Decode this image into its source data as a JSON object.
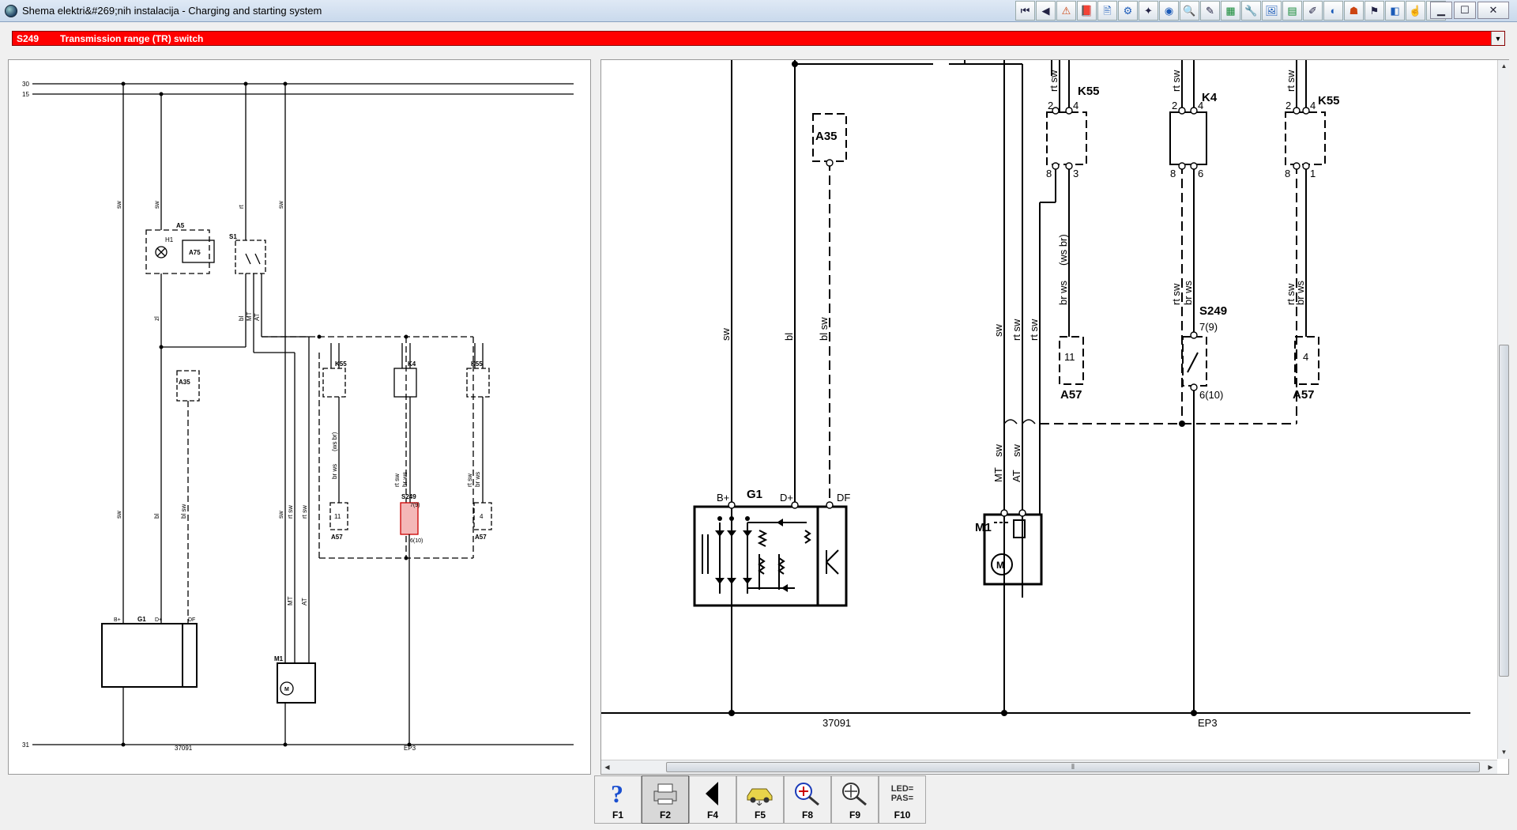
{
  "window": {
    "title": "Shema elektri&#269;nih instalacija - Charging and starting system",
    "controls": {
      "minimize": "▁",
      "maximize": "☐",
      "close": "✕"
    }
  },
  "toolbar": {
    "icons": [
      "first-page-icon",
      "prev-page-icon",
      "warning-icon",
      "book-icon",
      "document-icon",
      "gear-icon",
      "puzzle-icon",
      "globe-icon",
      "search-icon",
      "pencil-icon",
      "grid-icon",
      "tool-icon",
      "image-icon",
      "table-icon",
      "paint-icon",
      "camera-icon",
      "warning-lamp-icon",
      "settings-icon",
      "pin-icon",
      "hand-icon",
      "close-doc-icon"
    ],
    "glyphs": [
      "⏮",
      "◀",
      "⚠",
      "📕",
      "🖹",
      "⚙",
      "✦",
      "◉",
      "🔍",
      "✎",
      "▦",
      "🔧",
      "🖼",
      "▤",
      "✐",
      "◐",
      "☗",
      "⚑",
      "◧",
      "☝",
      "▭"
    ]
  },
  "component_selector": {
    "code": "S249",
    "name": "Transmission range (TR) switch",
    "arrow": "▼"
  },
  "left_diagram": {
    "rails": [
      "30",
      "15",
      "31"
    ],
    "components": {
      "a5": "A5",
      "a75": "A75",
      "h1": "H1",
      "s1": "S1",
      "a35": "A35",
      "k55a": "K55",
      "k4": "K4",
      "k55b": "K55",
      "s249": "S249",
      "s249_top": "7(9)",
      "s249_bot": "6(10)",
      "a57a": "A57",
      "a57b": "A57",
      "a57a_pin": "11",
      "a57b_pin": "4",
      "g1": "G1",
      "m1": "M1",
      "m_sym": "M",
      "bplus": "B+",
      "dplus": "D+",
      "df": "DF"
    },
    "wires": {
      "sw": "sw",
      "bl": "bl",
      "rt": "rt",
      "blsw": "bl sw",
      "rtsw": "rt sw",
      "brws": "br ws",
      "wsbr": "(ws br)",
      "mt": "MT",
      "at": "AT",
      "zl": "zl"
    },
    "ground_labels": [
      "37091",
      "EP3"
    ]
  },
  "right_diagram": {
    "components": {
      "a35": "A35",
      "k55a": "K55",
      "k4": "K4",
      "k55b": "K55",
      "a57a": "A57",
      "a57b": "A57",
      "a57a_pin": "11",
      "a57b_pin": "4",
      "s249": "S249",
      "s249_top": "7(9)",
      "s249_bot": "6(10)",
      "g1": "G1",
      "m1": "M1",
      "m_sym": "M",
      "bplus": "B+",
      "dplus": "D+",
      "df": "DF",
      "pins": {
        "p2": "2",
        "p4": "4",
        "p8": "8",
        "p3": "3",
        "p6": "6",
        "p1": "1"
      }
    },
    "wires": {
      "sw": "sw",
      "bl": "bl",
      "blsw": "bl sw",
      "rtsw": "rt sw",
      "brws": "br ws",
      "wsbr": "(ws br)",
      "mt": "MT",
      "at": "AT"
    },
    "ground_labels": [
      "37091",
      "EP3"
    ],
    "scroll": {
      "thumb_grip": "⦀"
    }
  },
  "function_keys": [
    {
      "label": "F1",
      "icon": "help-icon"
    },
    {
      "label": "F2",
      "icon": "print-icon",
      "active": true
    },
    {
      "label": "F4",
      "icon": "back-arrow-icon"
    },
    {
      "label": "F5",
      "icon": "car-icon"
    },
    {
      "label": "F8",
      "icon": "zoom-diagram-icon"
    },
    {
      "label": "F9",
      "icon": "zoom-icon"
    },
    {
      "label": "F10",
      "icon": "led-pass-icon",
      "text1": "LED=",
      "text2": "PAS="
    }
  ]
}
